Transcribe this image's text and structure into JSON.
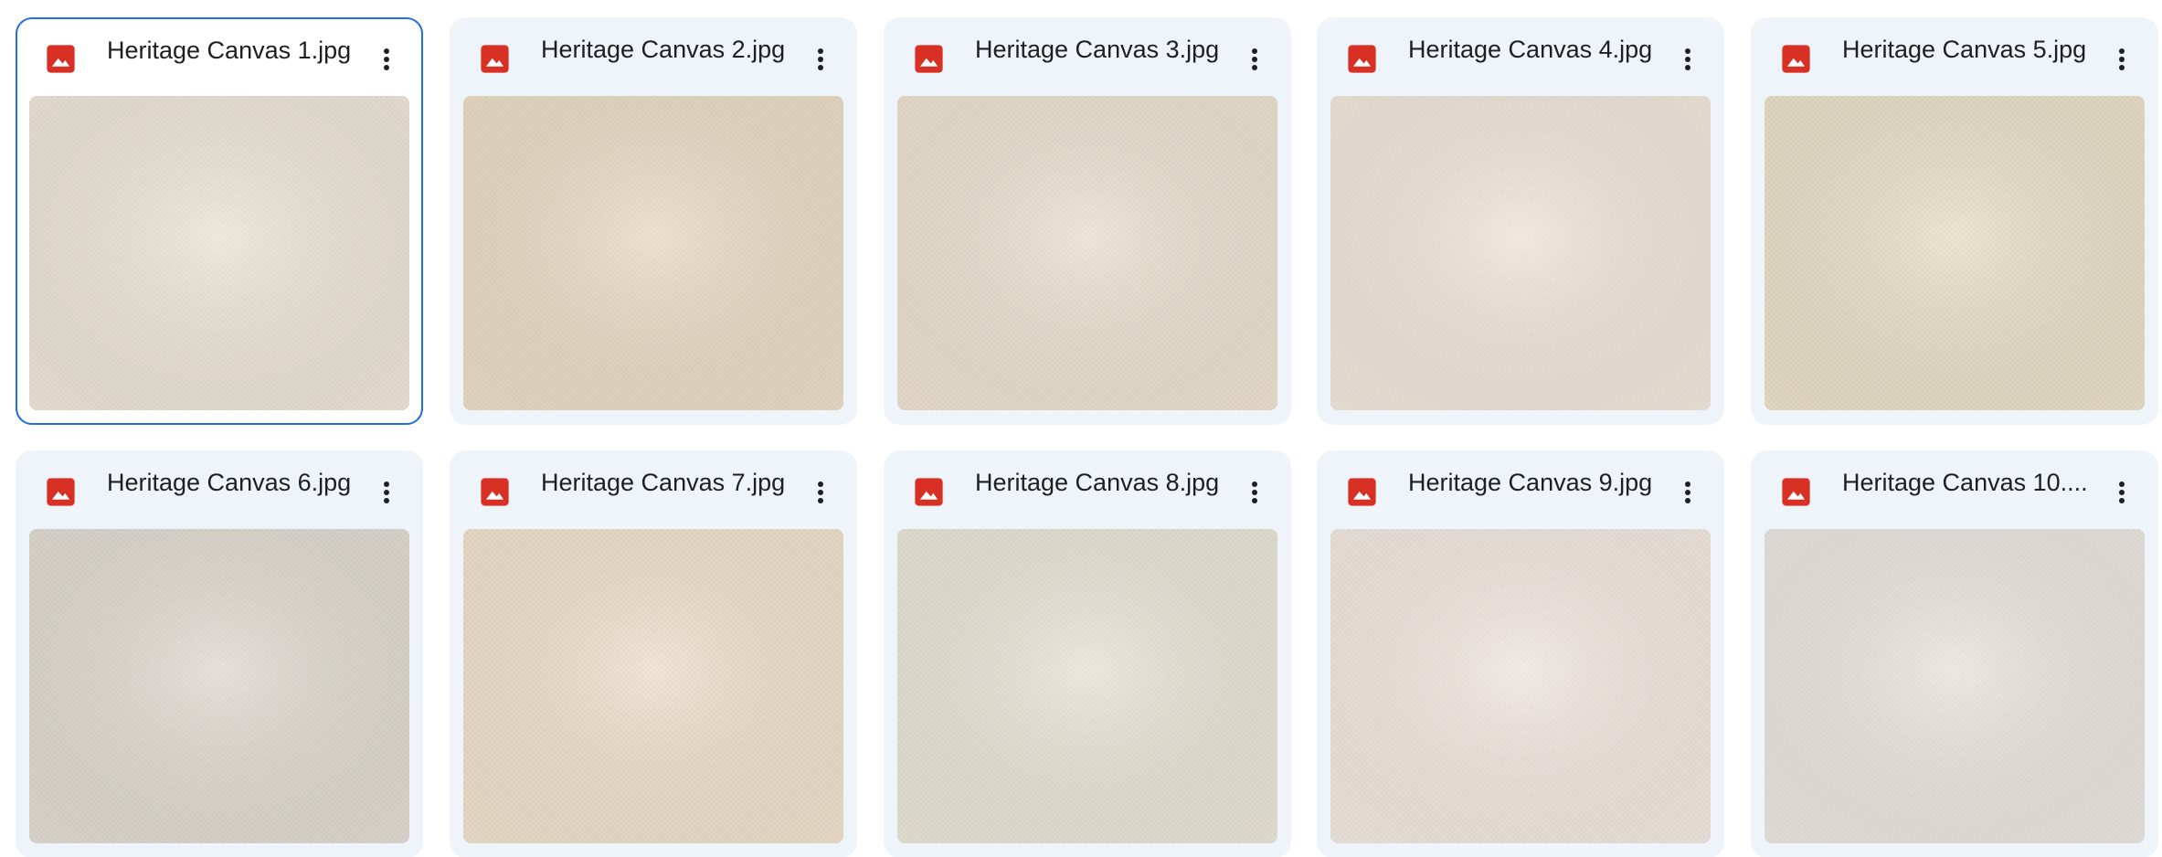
{
  "files": [
    {
      "name": "Heritage Canvas 1.jpg",
      "selected": true,
      "swatch": "#ebe5d6",
      "shade": "#e3dccb"
    },
    {
      "name": "Heritage Canvas 2.jpg",
      "selected": false,
      "swatch": "#e9dcc6",
      "shade": "#e1d2b9"
    },
    {
      "name": "Heritage Canvas 3.jpg",
      "selected": false,
      "swatch": "#ebe0d1",
      "shade": "#e2d6c4"
    },
    {
      "name": "Heritage Canvas 4.jpg",
      "selected": false,
      "swatch": "#ede5db",
      "shade": "#e6ddd1"
    },
    {
      "name": "Heritage Canvas 5.jpg",
      "selected": false,
      "swatch": "#e9e0c9",
      "shade": "#ded3b9"
    },
    {
      "name": "Heritage Canvas 6.jpg",
      "selected": false,
      "swatch": "#dfdbd2",
      "shade": "#d6d1c7"
    },
    {
      "name": "Heritage Canvas 7.jpg",
      "selected": false,
      "swatch": "#eee1cd",
      "shade": "#e4d4bd"
    },
    {
      "name": "Heritage Canvas 8.jpg",
      "selected": false,
      "swatch": "#e7e4d7",
      "shade": "#dedbcc"
    },
    {
      "name": "Heritage Canvas 9.jpg",
      "selected": false,
      "swatch": "#efe7df",
      "shade": "#e7ded4"
    },
    {
      "name": "Heritage Canvas 10....",
      "selected": false,
      "swatch": "#e8e5df",
      "shade": "#dfdcd5"
    }
  ],
  "icons": {
    "file_type": "image-icon",
    "menu": "more-vert-icon"
  },
  "colors": {
    "image_icon": "#d93025",
    "card_bg": "#eff3fa",
    "selected_border": "#1f6fe0",
    "menu_dots": "#1f1f1f"
  }
}
